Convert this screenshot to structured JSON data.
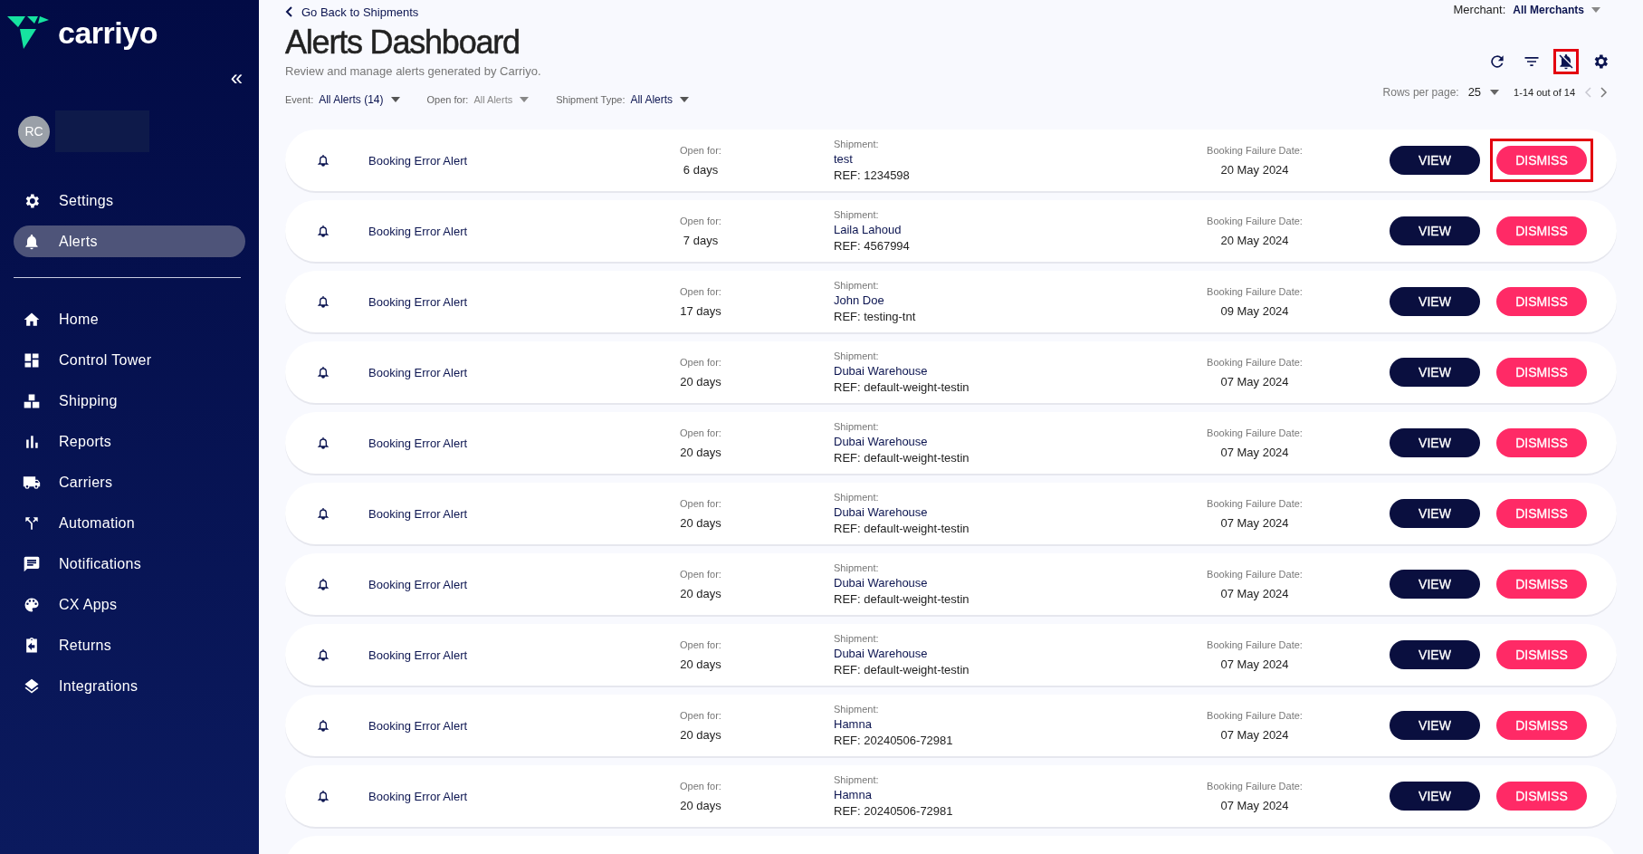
{
  "logo": {
    "text": "carriyo"
  },
  "sidebar": {
    "collapse": "«",
    "avatar": "RC",
    "top_items": [
      {
        "label": "Settings",
        "selected": false
      },
      {
        "label": "Alerts",
        "selected": true
      }
    ],
    "nav": [
      {
        "label": "Home",
        "selected": false
      },
      {
        "label": "Control Tower",
        "selected": false
      },
      {
        "label": "Shipping",
        "selected": false
      },
      {
        "label": "Reports",
        "selected": false
      },
      {
        "label": "Carriers",
        "selected": false
      },
      {
        "label": "Automation",
        "selected": false
      },
      {
        "label": "Notifications",
        "selected": false
      },
      {
        "label": "CX Apps",
        "selected": false
      },
      {
        "label": "Returns",
        "selected": false
      },
      {
        "label": "Integrations",
        "selected": false
      }
    ]
  },
  "header": {
    "back_link": "Go Back to Shipments",
    "title": "Alerts Dashboard",
    "subtitle": "Review and manage alerts generated by Carriyo.",
    "merchant": {
      "label": "Merchant:",
      "value": "All Merchants"
    },
    "filters": [
      {
        "label": "Event:",
        "value": "All Alerts  (14)",
        "set": true
      },
      {
        "label": "Open for:",
        "value": "All Alerts",
        "set": false
      },
      {
        "label": "Shipment Type:",
        "value": "All Alerts",
        "set": true
      }
    ],
    "toolbar": [
      {
        "highlighted": false
      },
      {
        "highlighted": false
      },
      {
        "highlighted": true
      },
      {
        "highlighted": false
      }
    ],
    "pagination": {
      "label": "Rows per page:",
      "value": "25",
      "range": "1-14 out of 14",
      "prev_disabled": true,
      "next_disabled": false
    }
  },
  "alerts": [
    {
      "title": "Booking Error Alert",
      "open_label": "Open for:",
      "open": "6 days",
      "ship_label": "Shipment:",
      "ship": "test",
      "ref": "REF: 1234598",
      "date_label": "Booking Failure Date:",
      "date": "20 May 2024",
      "view": "VIEW",
      "dismiss": "DISMISS",
      "highlighted": true
    },
    {
      "title": "Booking Error Alert",
      "open_label": "Open for:",
      "open": "7 days",
      "ship_label": "Shipment:",
      "ship": "Laila Lahoud",
      "ref": "REF: 4567994",
      "date_label": "Booking Failure Date:",
      "date": "20 May 2024",
      "view": "VIEW",
      "dismiss": "DISMISS",
      "highlighted": false
    },
    {
      "title": "Booking Error Alert",
      "open_label": "Open for:",
      "open": "17 days",
      "ship_label": "Shipment:",
      "ship": "John Doe",
      "ref": "REF: testing-tnt",
      "date_label": "Booking Failure Date:",
      "date": "09 May 2024",
      "view": "VIEW",
      "dismiss": "DISMISS",
      "highlighted": false
    },
    {
      "title": "Booking Error Alert",
      "open_label": "Open for:",
      "open": "20 days",
      "ship_label": "Shipment:",
      "ship": "Dubai Warehouse",
      "ref": "REF: default-weight-testin",
      "date_label": "Booking Failure Date:",
      "date": "07 May 2024",
      "view": "VIEW",
      "dismiss": "DISMISS",
      "highlighted": false
    },
    {
      "title": "Booking Error Alert",
      "open_label": "Open for:",
      "open": "20 days",
      "ship_label": "Shipment:",
      "ship": "Dubai Warehouse",
      "ref": "REF: default-weight-testin",
      "date_label": "Booking Failure Date:",
      "date": "07 May 2024",
      "view": "VIEW",
      "dismiss": "DISMISS",
      "highlighted": false
    },
    {
      "title": "Booking Error Alert",
      "open_label": "Open for:",
      "open": "20 days",
      "ship_label": "Shipment:",
      "ship": "Dubai Warehouse",
      "ref": "REF: default-weight-testin",
      "date_label": "Booking Failure Date:",
      "date": "07 May 2024",
      "view": "VIEW",
      "dismiss": "DISMISS",
      "highlighted": false
    },
    {
      "title": "Booking Error Alert",
      "open_label": "Open for:",
      "open": "20 days",
      "ship_label": "Shipment:",
      "ship": "Dubai Warehouse",
      "ref": "REF: default-weight-testin",
      "date_label": "Booking Failure Date:",
      "date": "07 May 2024",
      "view": "VIEW",
      "dismiss": "DISMISS",
      "highlighted": false
    },
    {
      "title": "Booking Error Alert",
      "open_label": "Open for:",
      "open": "20 days",
      "ship_label": "Shipment:",
      "ship": "Dubai Warehouse",
      "ref": "REF: default-weight-testin",
      "date_label": "Booking Failure Date:",
      "date": "07 May 2024",
      "view": "VIEW",
      "dismiss": "DISMISS",
      "highlighted": false
    },
    {
      "title": "Booking Error Alert",
      "open_label": "Open for:",
      "open": "20 days",
      "ship_label": "Shipment:",
      "ship": "Hamna",
      "ref": "REF: 20240506-72981",
      "date_label": "Booking Failure Date:",
      "date": "07 May 2024",
      "view": "VIEW",
      "dismiss": "DISMISS",
      "highlighted": false
    },
    {
      "title": "Booking Error Alert",
      "open_label": "Open for:",
      "open": "20 days",
      "ship_label": "Shipment:",
      "ship": "Hamna",
      "ref": "REF: 20240506-72981",
      "date_label": "Booking Failure Date:",
      "date": "07 May 2024",
      "view": "VIEW",
      "dismiss": "DISMISS",
      "highlighted": false
    }
  ]
}
